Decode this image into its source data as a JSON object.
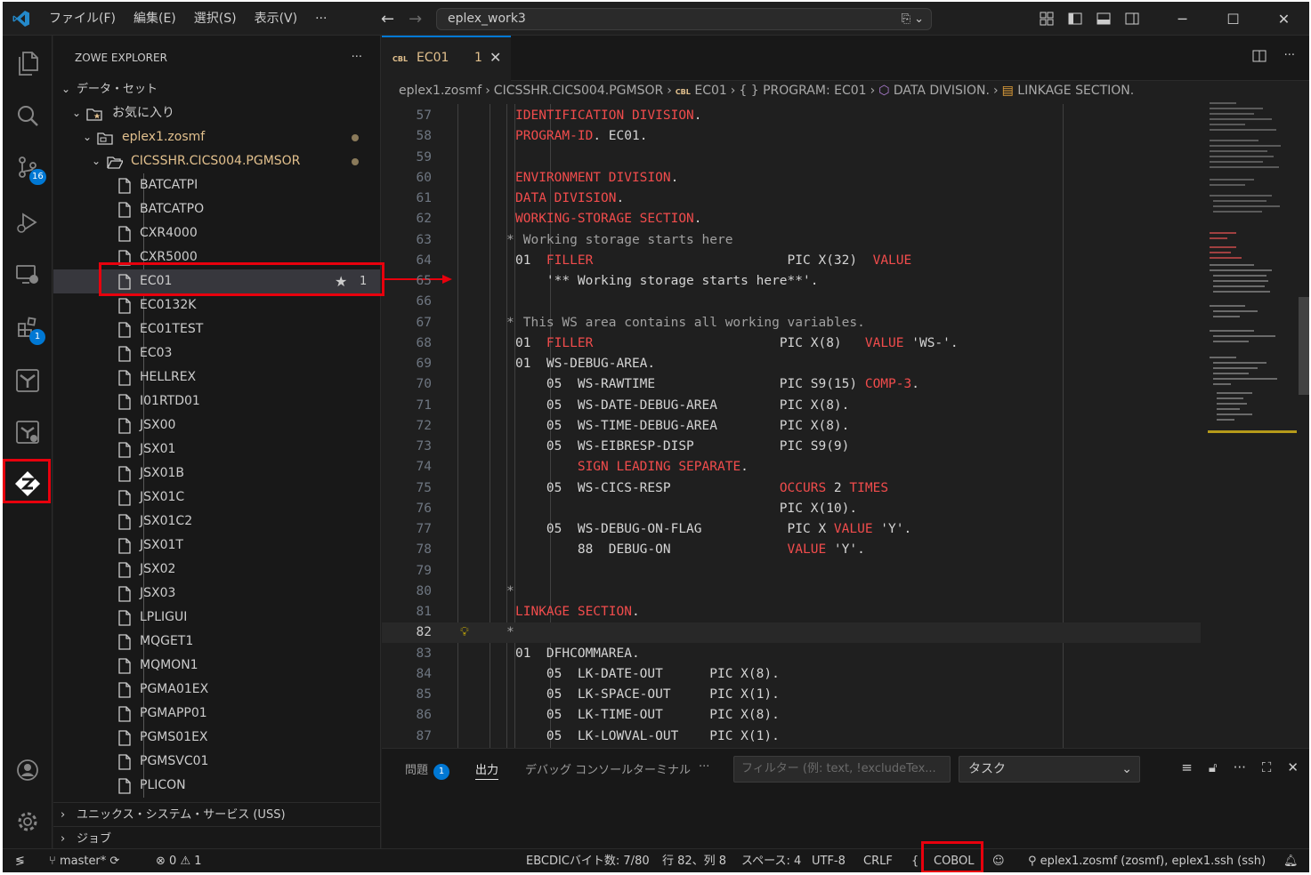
{
  "titlebar": {
    "menu": [
      "ファイル(F)",
      "編集(E)",
      "選択(S)",
      "表示(V)",
      "···"
    ],
    "search": "eplex_work3"
  },
  "activity": {
    "scm_badge": "16",
    "extensions_badge": "1"
  },
  "sidebar": {
    "title": "ZOWE EXPLORER",
    "more": "···",
    "datasets_label": "データ・セット",
    "favorites_label": "お気に入り",
    "profile_label": "eplex1.zosmf",
    "pds_label": "CICSSHR.CICS004.PGMSOR",
    "members": [
      "BATCATPI",
      "BATCATPO",
      "CXR4000",
      "CXR5000",
      "EC01",
      "EC0132K",
      "EC01TEST",
      "EC03",
      "HELLREX",
      "I01RTD01",
      "JSX00",
      "JSX01",
      "JSX01B",
      "JSX01C",
      "JSX01C2",
      "JSX01T",
      "JSX02",
      "JSX03",
      "LPLIGUI",
      "MQGET1",
      "MQMON1",
      "PGMA01EX",
      "PGMAPP01",
      "PGMS01EX",
      "PGMSVC01",
      "PLICON"
    ],
    "selected_badge": "1",
    "uss_label": "ユニックス・システム・サービス (USS)",
    "jobs_label": "ジョブ"
  },
  "tab": {
    "lang_tag": "CBL",
    "name": "EC01",
    "problems": "1",
    "close": "✕"
  },
  "breadcrumb": {
    "profile": "eplex1.zosmf",
    "dataset": "CICSSHR.CICS004.PGMSOR",
    "lang_tag": "CBL",
    "member": "EC01",
    "program": "PROGRAM: EC01",
    "division": "DATA DIVISION.",
    "section": "LINKAGE SECTION."
  },
  "code": {
    "current_line": 82,
    "lines": [
      {
        "n": "57",
        "segs": [
          [
            "k",
            "IDENTIFICATION DIVISION"
          ],
          [
            "w",
            "."
          ]
        ]
      },
      {
        "n": "58",
        "segs": [
          [
            "k",
            "PROGRAM-ID"
          ],
          [
            "w",
            ". EC01."
          ]
        ]
      },
      {
        "n": "59",
        "segs": []
      },
      {
        "n": "60",
        "segs": [
          [
            "k",
            "ENVIRONMENT DIVISION"
          ],
          [
            "w",
            "."
          ]
        ]
      },
      {
        "n": "61",
        "segs": [
          [
            "k",
            "DATA DIVISION"
          ],
          [
            "w",
            "."
          ]
        ]
      },
      {
        "n": "62",
        "segs": [
          [
            "k",
            "WORKING-STORAGE SECTION"
          ],
          [
            "w",
            "."
          ]
        ]
      },
      {
        "n": "63",
        "segs": [
          [
            "c",
            " Working storage starts here"
          ]
        ],
        "star": true
      },
      {
        "n": "64",
        "segs": [
          [
            "w",
            "01  "
          ],
          [
            "k",
            "FILLER"
          ],
          [
            "w",
            "                         PIC X(32)  "
          ],
          [
            "k",
            "VALUE"
          ]
        ]
      },
      {
        "n": "65",
        "segs": [
          [
            "w",
            "    '** Working storage starts here**'."
          ]
        ]
      },
      {
        "n": "66",
        "segs": []
      },
      {
        "n": "67",
        "segs": [
          [
            "c",
            " This WS area contains all working variables."
          ]
        ],
        "star": true
      },
      {
        "n": "68",
        "segs": [
          [
            "w",
            "01  "
          ],
          [
            "k",
            "FILLER"
          ],
          [
            "w",
            "                        PIC X(8)   "
          ],
          [
            "k",
            "VALUE"
          ],
          [
            "w",
            " 'WS-'."
          ]
        ]
      },
      {
        "n": "69",
        "segs": [
          [
            "w",
            "01  WS-DEBUG-AREA."
          ]
        ]
      },
      {
        "n": "70",
        "segs": [
          [
            "w",
            "    05  WS-RAWTIME                PIC S9(15) "
          ],
          [
            "k",
            "COMP-3"
          ],
          [
            "w",
            "."
          ]
        ]
      },
      {
        "n": "71",
        "segs": [
          [
            "w",
            "    05  WS-DATE-DEBUG-AREA        PIC X(8)."
          ]
        ]
      },
      {
        "n": "72",
        "segs": [
          [
            "w",
            "    05  WS-TIME-DEBUG-AREA        PIC X(8)."
          ]
        ]
      },
      {
        "n": "73",
        "segs": [
          [
            "w",
            "    05  WS-EIBRESP-DISP           PIC S9(9)"
          ]
        ]
      },
      {
        "n": "74",
        "segs": [
          [
            "w",
            "        "
          ],
          [
            "k",
            "SIGN LEADING SEPARATE"
          ],
          [
            "w",
            "."
          ]
        ]
      },
      {
        "n": "75",
        "segs": [
          [
            "w",
            "    05  WS-CICS-RESP              "
          ],
          [
            "k",
            "OCCURS"
          ],
          [
            "w",
            " 2 "
          ],
          [
            "k",
            "TIMES"
          ]
        ]
      },
      {
        "n": "76",
        "segs": [
          [
            "w",
            "                                  PIC X(10)."
          ]
        ]
      },
      {
        "n": "77",
        "segs": [
          [
            "w",
            "    05  WS-DEBUG-ON-FLAG           PIC X "
          ],
          [
            "k",
            "VALUE"
          ],
          [
            "w",
            " 'Y'."
          ]
        ]
      },
      {
        "n": "78",
        "segs": [
          [
            "w",
            "        88  DEBUG-ON               "
          ],
          [
            "k",
            "VALUE"
          ],
          [
            "w",
            " 'Y'."
          ]
        ]
      },
      {
        "n": "79",
        "segs": []
      },
      {
        "n": "80",
        "segs": [],
        "star": true
      },
      {
        "n": "81",
        "segs": [
          [
            "k",
            "LINKAGE SECTION"
          ],
          [
            "w",
            "."
          ]
        ]
      },
      {
        "n": "82",
        "segs": [],
        "star": true
      },
      {
        "n": "83",
        "segs": [
          [
            "w",
            "01  DFHCOMMAREA."
          ]
        ]
      },
      {
        "n": "84",
        "segs": [
          [
            "w",
            "    05  LK-DATE-OUT      PIC X(8)."
          ]
        ]
      },
      {
        "n": "85",
        "segs": [
          [
            "w",
            "    05  LK-SPACE-OUT     PIC X(1)."
          ]
        ]
      },
      {
        "n": "86",
        "segs": [
          [
            "w",
            "    05  LK-TIME-OUT      PIC X(8)."
          ]
        ]
      },
      {
        "n": "87",
        "segs": [
          [
            "w",
            "    05  LK-LOWVAL-OUT    PIC X(1)."
          ]
        ]
      }
    ]
  },
  "panel": {
    "problems": "問題",
    "problems_count": "1",
    "output": "出力",
    "debug_console": "デバッグ コンソール",
    "terminal": "ターミナル",
    "more": "···",
    "filter_placeholder": "フィルター (例: text, !excludeTex...",
    "select_value": "タスク"
  },
  "status": {
    "branch": "master*",
    "errors": "0",
    "warnings": "1",
    "ebcdic": "EBCDICバイト数: 7/80",
    "position": "行 82、列 8",
    "spaces": "スペース: 4",
    "encoding": "UTF-8",
    "eol": "CRLF",
    "brace": "{",
    "language": "COBOL",
    "connection": "eplex1.zosmf (zosmf), eplex1.ssh (ssh)"
  },
  "colors": {
    "accent": "#0078d4",
    "highlight_box": "#e8000d",
    "keyword": "#f14c4c",
    "modified": "#e2c08d"
  }
}
